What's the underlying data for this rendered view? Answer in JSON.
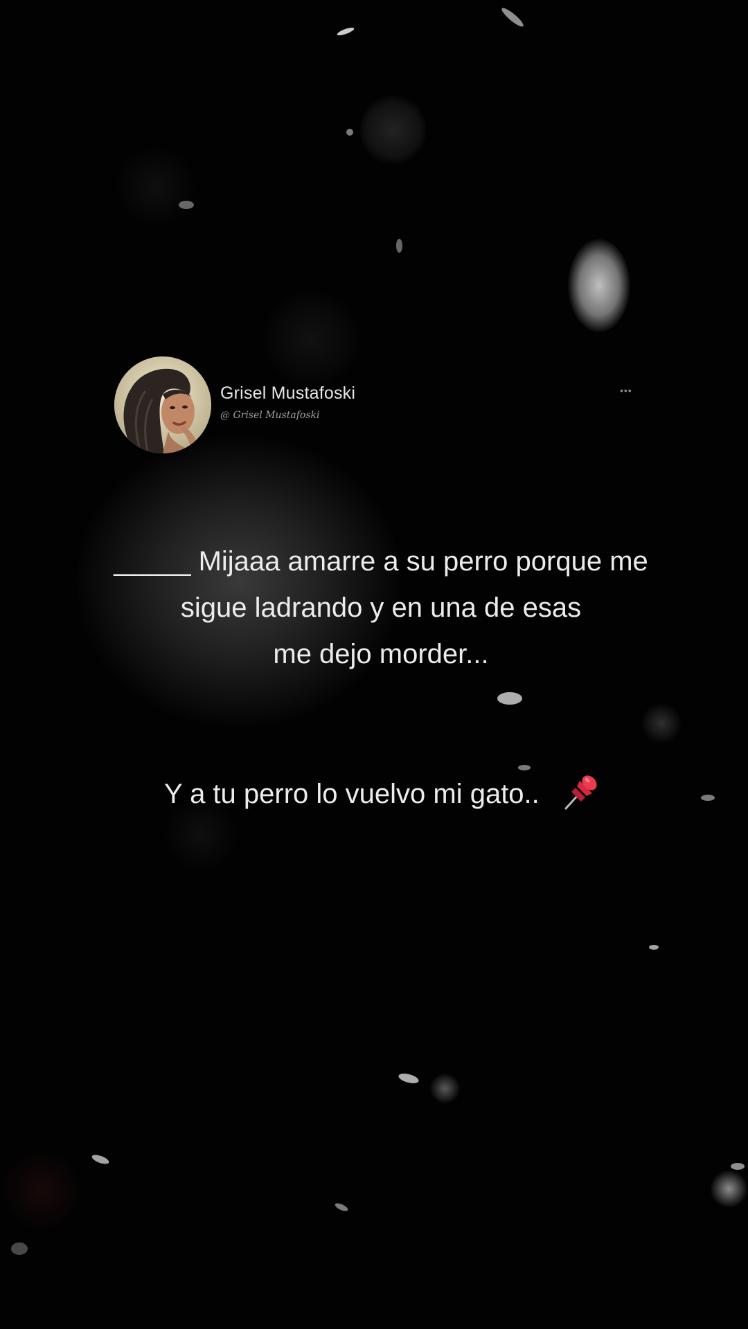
{
  "post": {
    "author": {
      "name": "Grisel Mustafoski",
      "handle": "@ Grisel Mustafoski",
      "avatar": "avatar-photo"
    },
    "more_icon": "more-dots-icon",
    "message_lines": [
      "_____ Mijaaa amarre a su perro porque me",
      "sigue ladrando y en una de esas",
      "me dejo morder..."
    ],
    "reply": "Y a tu perro lo vuelvo mi gato..",
    "reply_icon": "pushpin-icon"
  },
  "colors": {
    "background": "#020202",
    "text": "#ececec",
    "pin_red": "#d8283f"
  }
}
